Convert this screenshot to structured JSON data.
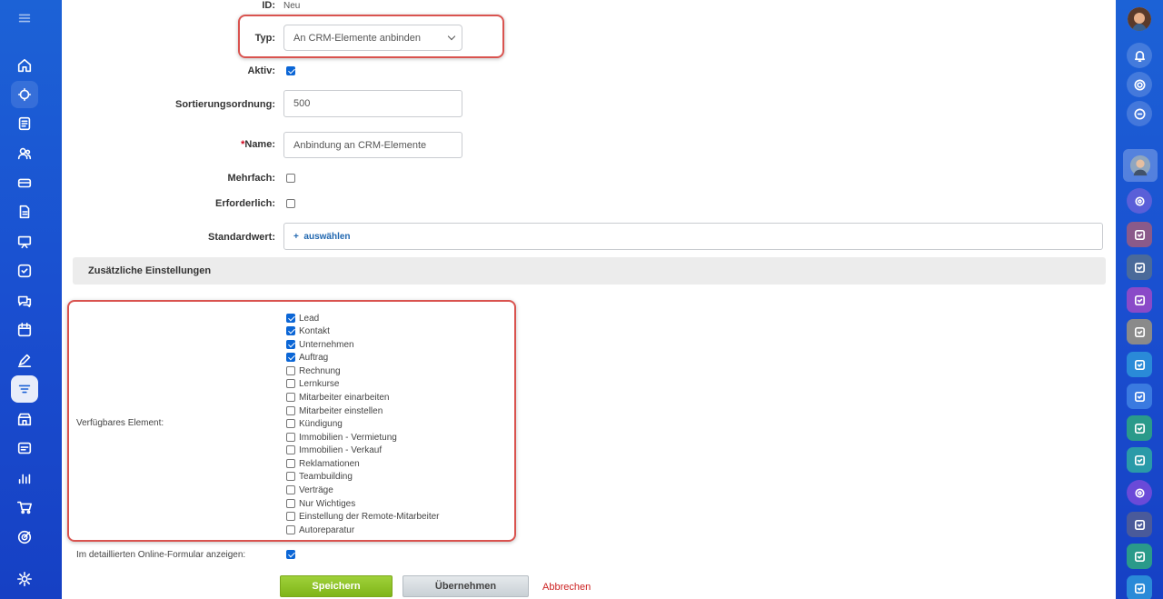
{
  "form": {
    "id_label": "ID:",
    "id_value": "Neu",
    "type_label": "Typ:",
    "type_value": "An CRM-Elemente anbinden",
    "active_label": "Aktiv:",
    "active_checked": true,
    "sort_label": "Sortierungsordnung:",
    "sort_value": "500",
    "name_required_mark": "*",
    "name_label": "Name:",
    "name_value": "Anbindung an CRM-Elemente",
    "multiple_label": "Mehrfach:",
    "multiple_checked": false,
    "required_label": "Erforderlich:",
    "required_checked": false,
    "default_label": "Standardwert:",
    "default_link_plus": "+",
    "default_link_label": "auswählen"
  },
  "additional": {
    "section_title": "Zusätzliche Einstellungen",
    "available_label": "Verfügbares Element:",
    "elements": [
      {
        "label": "Lead",
        "checked": true
      },
      {
        "label": "Kontakt",
        "checked": true
      },
      {
        "label": "Unternehmen",
        "checked": true
      },
      {
        "label": "Auftrag",
        "checked": true
      },
      {
        "label": "Rechnung",
        "checked": false
      },
      {
        "label": "Lernkurse",
        "checked": false
      },
      {
        "label": "Mitarbeiter einarbeiten",
        "checked": false
      },
      {
        "label": "Mitarbeiter einstellen",
        "checked": false
      },
      {
        "label": "Kündigung",
        "checked": false
      },
      {
        "label": "Immobilien - Vermietung",
        "checked": false
      },
      {
        "label": "Immobilien - Verkauf",
        "checked": false
      },
      {
        "label": "Reklamationen",
        "checked": false
      },
      {
        "label": "Teambuilding",
        "checked": false
      },
      {
        "label": "Verträge",
        "checked": false
      },
      {
        "label": "Nur Wichtiges",
        "checked": false
      },
      {
        "label": "Einstellung der Remote-Mitarbeiter",
        "checked": false
      },
      {
        "label": "Autoreparatur",
        "checked": false
      }
    ],
    "online_form_label": "Im detaillierten Online-Formular anzeigen:",
    "online_form_checked": true
  },
  "buttons": {
    "save": "Speichern",
    "apply": "Übernehmen",
    "cancel": "Abbrechen"
  },
  "left_sidebar_icons": [
    "menu-icon",
    "home-icon",
    "feed-icon",
    "tasks-icon",
    "contacts-icon",
    "drive-icon",
    "docs-icon",
    "presentation-icon",
    "checklist-icon",
    "chat-icon",
    "calendar-icon",
    "sign-icon",
    "crm-filter-icon",
    "store-icon",
    "id-card-icon",
    "analytics-icon",
    "cart-icon",
    "target-icon",
    "settings-icon"
  ],
  "right_sidebar_icons": [
    "user-avatar",
    "bell-icon",
    "copilot-icon",
    "chat-search-icon",
    "employee-avatar",
    "spiral-icon",
    "task-icon"
  ],
  "colors": {
    "sidebar_blue": "#1c62d6",
    "highlight_red": "#d9534f",
    "save_green": "#7fb518",
    "checkbox_blue": "#0b66d6",
    "link_blue": "#2067b0",
    "cancel_red": "#cc2222"
  }
}
